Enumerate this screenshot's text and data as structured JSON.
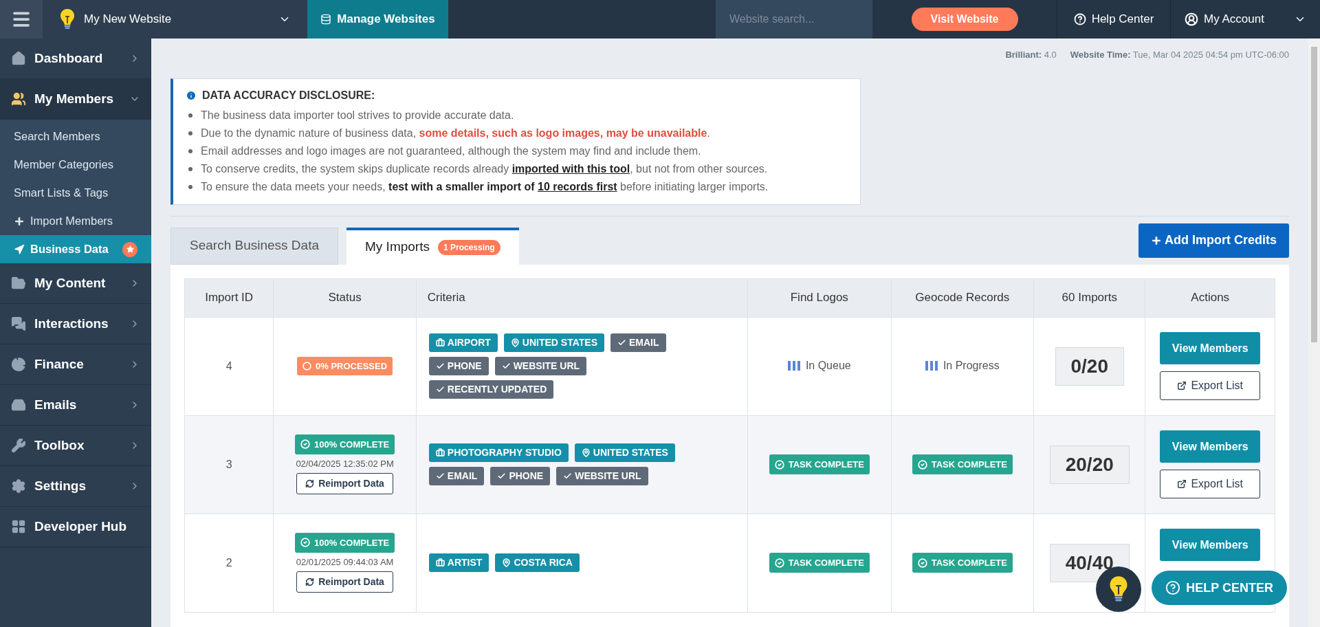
{
  "topbar": {
    "site_name": "My New Website",
    "manage_button": "Manage Websites",
    "search": {
      "placeholder": "Website search..."
    },
    "visit_button": "Visit Website",
    "help": "Help Center",
    "account": "My Account"
  },
  "sidebar": {
    "items": [
      {
        "label": "Dashboard",
        "kind": "group",
        "expanded": false
      },
      {
        "label": "My Members",
        "kind": "group",
        "expanded": true,
        "children": [
          {
            "label": "Search Members",
            "selected": false
          },
          {
            "label": "Member Categories",
            "selected": false
          },
          {
            "label": "Smart Lists & Tags",
            "selected": false
          },
          {
            "label": "Import Members",
            "selected": false
          },
          {
            "label": "Business Data",
            "selected": true
          }
        ]
      },
      {
        "label": "My Content",
        "kind": "group",
        "expanded": false
      },
      {
        "label": "Interactions",
        "kind": "group",
        "expanded": false
      },
      {
        "label": "Finance",
        "kind": "group",
        "expanded": false
      },
      {
        "label": "Emails",
        "kind": "group",
        "expanded": false
      },
      {
        "label": "Toolbox",
        "kind": "group",
        "expanded": false
      },
      {
        "label": "Settings",
        "kind": "group",
        "expanded": false
      },
      {
        "label": "Developer Hub",
        "kind": "link"
      }
    ]
  },
  "meta": [
    {
      "label": "Brilliant:",
      "value": "4.0"
    },
    {
      "label": "Website Time:",
      "value": "Tue, Mar 04 2025 04:54 pm UTC-06:00"
    }
  ],
  "disclosure": {
    "title": "DATA ACCURACY DISCLOSURE:",
    "items": [
      [
        {
          "text": "The business data importer tool strives to provide accurate data.",
          "kind": "plain"
        }
      ],
      [
        {
          "text": "Due to the dynamic nature of business data, ",
          "kind": "plain"
        },
        {
          "text": "some details, such as logo images, may be unavailable",
          "kind": "alert"
        },
        {
          "text": ".",
          "kind": "plain"
        }
      ],
      [
        {
          "text": "Email addresses and logo images are not guaranteed, although the system may find and include them.",
          "kind": "plain"
        }
      ],
      [
        {
          "text": "To conserve credits, the system skips duplicate records already ",
          "kind": "plain"
        },
        {
          "text": "imported with this tool",
          "kind": "link"
        },
        {
          "text": ", but not from other sources.",
          "kind": "plain"
        }
      ],
      [
        {
          "text": "To ensure the data meets your needs, ",
          "kind": "plain"
        },
        {
          "text": "test with a smaller import of ",
          "kind": "strong"
        },
        {
          "text": "10 records first",
          "kind": "link"
        },
        {
          "text": " before initiating larger imports.",
          "kind": "plain"
        }
      ]
    ]
  },
  "tabs": [
    {
      "label": "Search Business Data",
      "selected": false
    },
    {
      "label": "My Imports",
      "selected": true,
      "badge": "1 Processing"
    }
  ],
  "add_credits_button": "Add Import Credits",
  "table": {
    "columns": [
      "Import ID",
      "Status",
      "Criteria",
      "Find Logos",
      "Geocode Records",
      "60 Imports",
      "Actions"
    ],
    "rows": [
      {
        "id": "4",
        "status": {
          "kind": "processing",
          "label": "0% PROCESSED"
        },
        "criteria": [
          {
            "label": "AIRPORT",
            "kind": "category"
          },
          {
            "label": "UNITED STATES",
            "kind": "location"
          },
          {
            "label": "EMAIL",
            "kind": "field"
          },
          {
            "label": "PHONE",
            "kind": "field"
          },
          {
            "label": "WEBSITE URL",
            "kind": "field"
          },
          {
            "label": "RECENTLY UPDATED",
            "kind": "field"
          }
        ],
        "find_logos": {
          "kind": "progress",
          "label": "In Queue"
        },
        "geocode": {
          "kind": "progress",
          "label": "In Progress"
        },
        "count": "0/20",
        "actions": [
          "View Members",
          "Export List"
        ]
      },
      {
        "id": "3",
        "status": {
          "kind": "complete",
          "label": "100% COMPLETE",
          "date": "02/04/2025 12:35:02 PM",
          "button": "Reimport Data"
        },
        "criteria": [
          {
            "label": "PHOTOGRAPHY STUDIO",
            "kind": "category"
          },
          {
            "label": "UNITED STATES",
            "kind": "location"
          },
          {
            "label": "EMAIL",
            "kind": "field"
          },
          {
            "label": "PHONE",
            "kind": "field"
          },
          {
            "label": "WEBSITE URL",
            "kind": "field"
          }
        ],
        "find_logos": {
          "kind": "complete",
          "label": "TASK COMPLETE"
        },
        "geocode": {
          "kind": "complete",
          "label": "TASK COMPLETE"
        },
        "count": "20/20",
        "actions": [
          "View Members",
          "Export List"
        ]
      },
      {
        "id": "2",
        "status": {
          "kind": "complete",
          "label": "100% COMPLETE",
          "date": "02/01/2025 09:44:03 AM",
          "button": "Reimport Data"
        },
        "criteria": [
          {
            "label": "ARTIST",
            "kind": "category"
          },
          {
            "label": "COSTA RICA",
            "kind": "location"
          }
        ],
        "find_logos": {
          "kind": "complete",
          "label": "TASK COMPLETE"
        },
        "geocode": {
          "kind": "complete",
          "label": "TASK COMPLETE"
        },
        "count": "40/40",
        "actions": [
          "View Members"
        ]
      }
    ]
  },
  "help_button": "HELP CENTER"
}
